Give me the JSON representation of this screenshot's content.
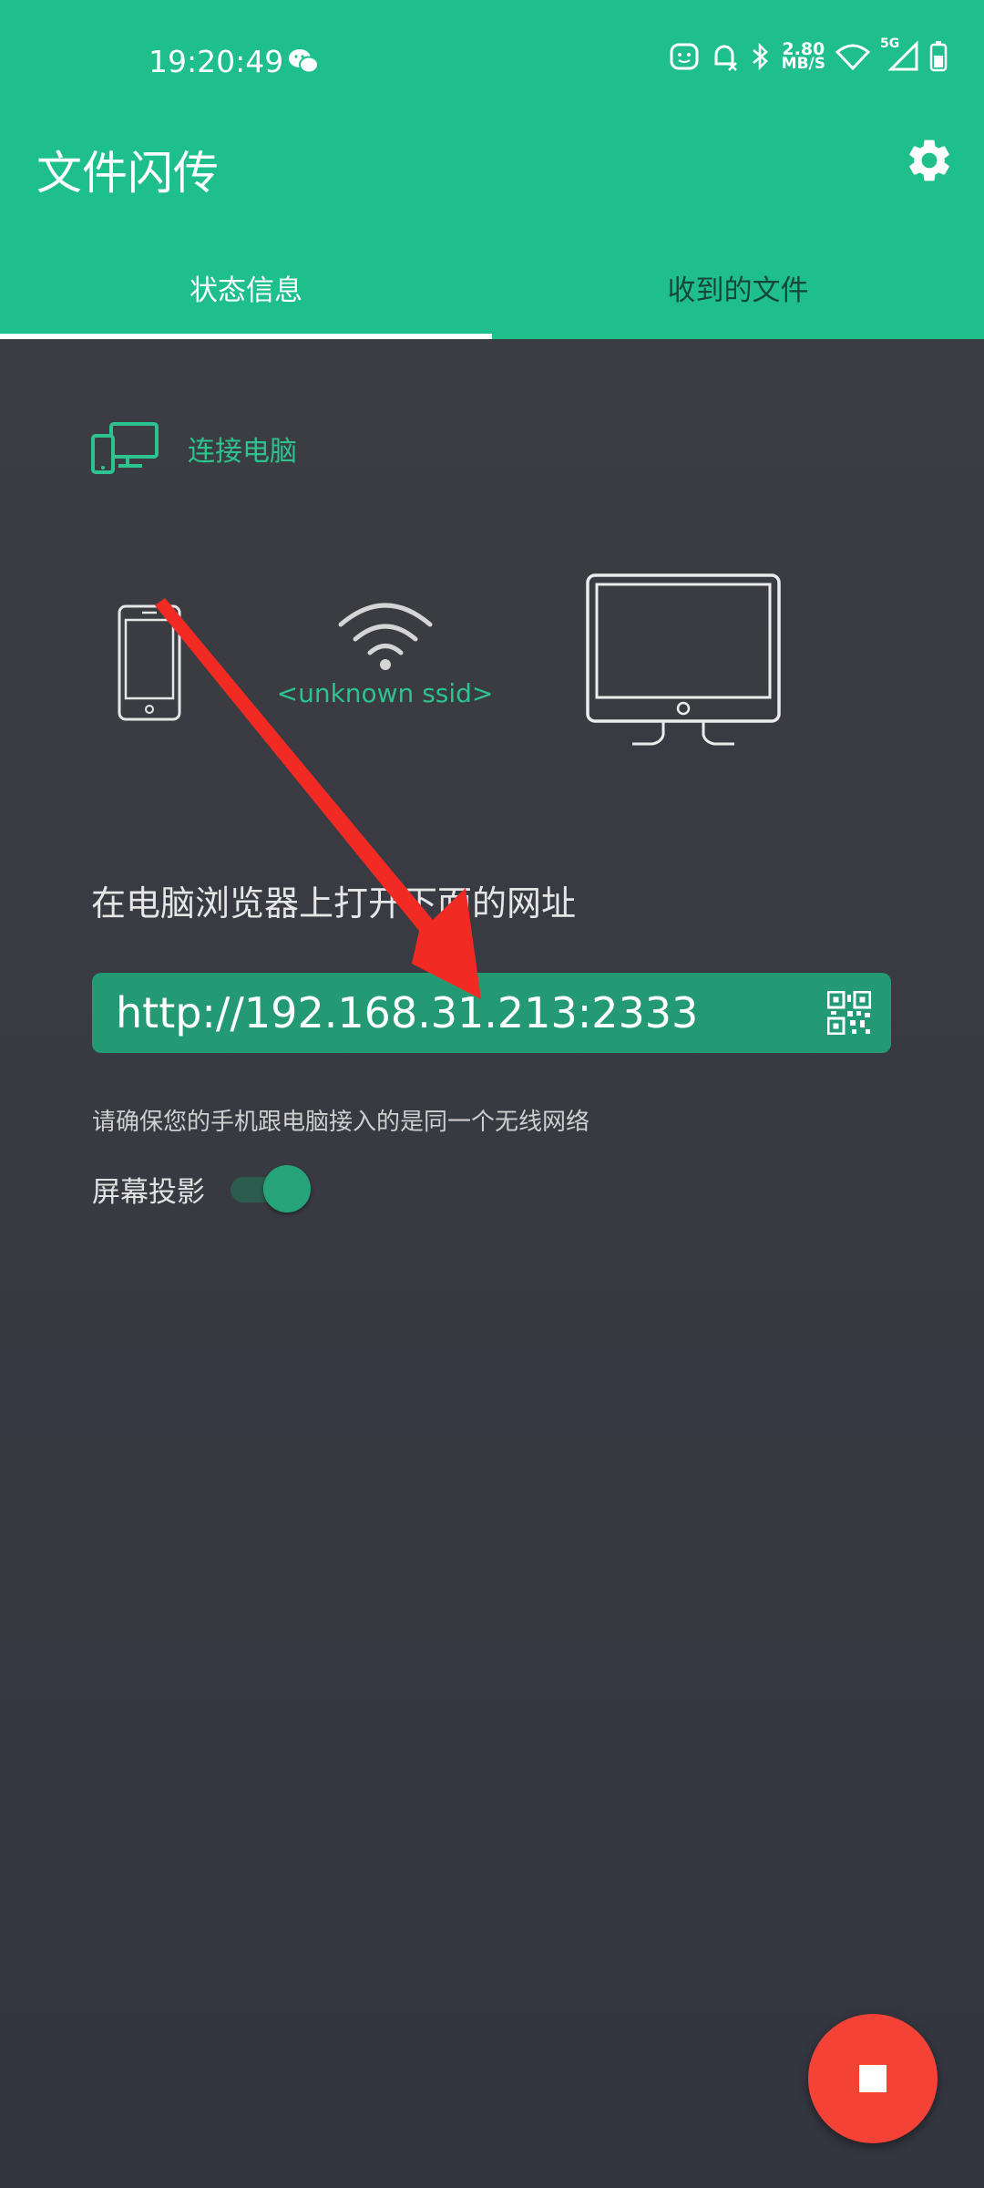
{
  "status_bar": {
    "time": "19:20:49",
    "net_speed_value": "2.80",
    "net_speed_unit": "MB/S",
    "signal_label": "5G"
  },
  "appbar": {
    "title": "文件闪传"
  },
  "tabs": [
    {
      "label": "状态信息",
      "active": true
    },
    {
      "label": "收到的文件",
      "active": false
    }
  ],
  "connect": {
    "label": "连接电脑"
  },
  "network": {
    "ssid": "<unknown ssid>"
  },
  "instruction": "在电脑浏览器上打开下面的网址",
  "url": "http://192.168.31.213:2333",
  "note": "请确保您的手机跟电脑接入的是同一个无线网络",
  "projection": {
    "label": "屏幕投影",
    "enabled": true
  },
  "colors": {
    "brand": "#1FBF8B",
    "url_bg": "#249A74",
    "fab": "#F44336",
    "annotation_arrow": "#F22A24"
  }
}
